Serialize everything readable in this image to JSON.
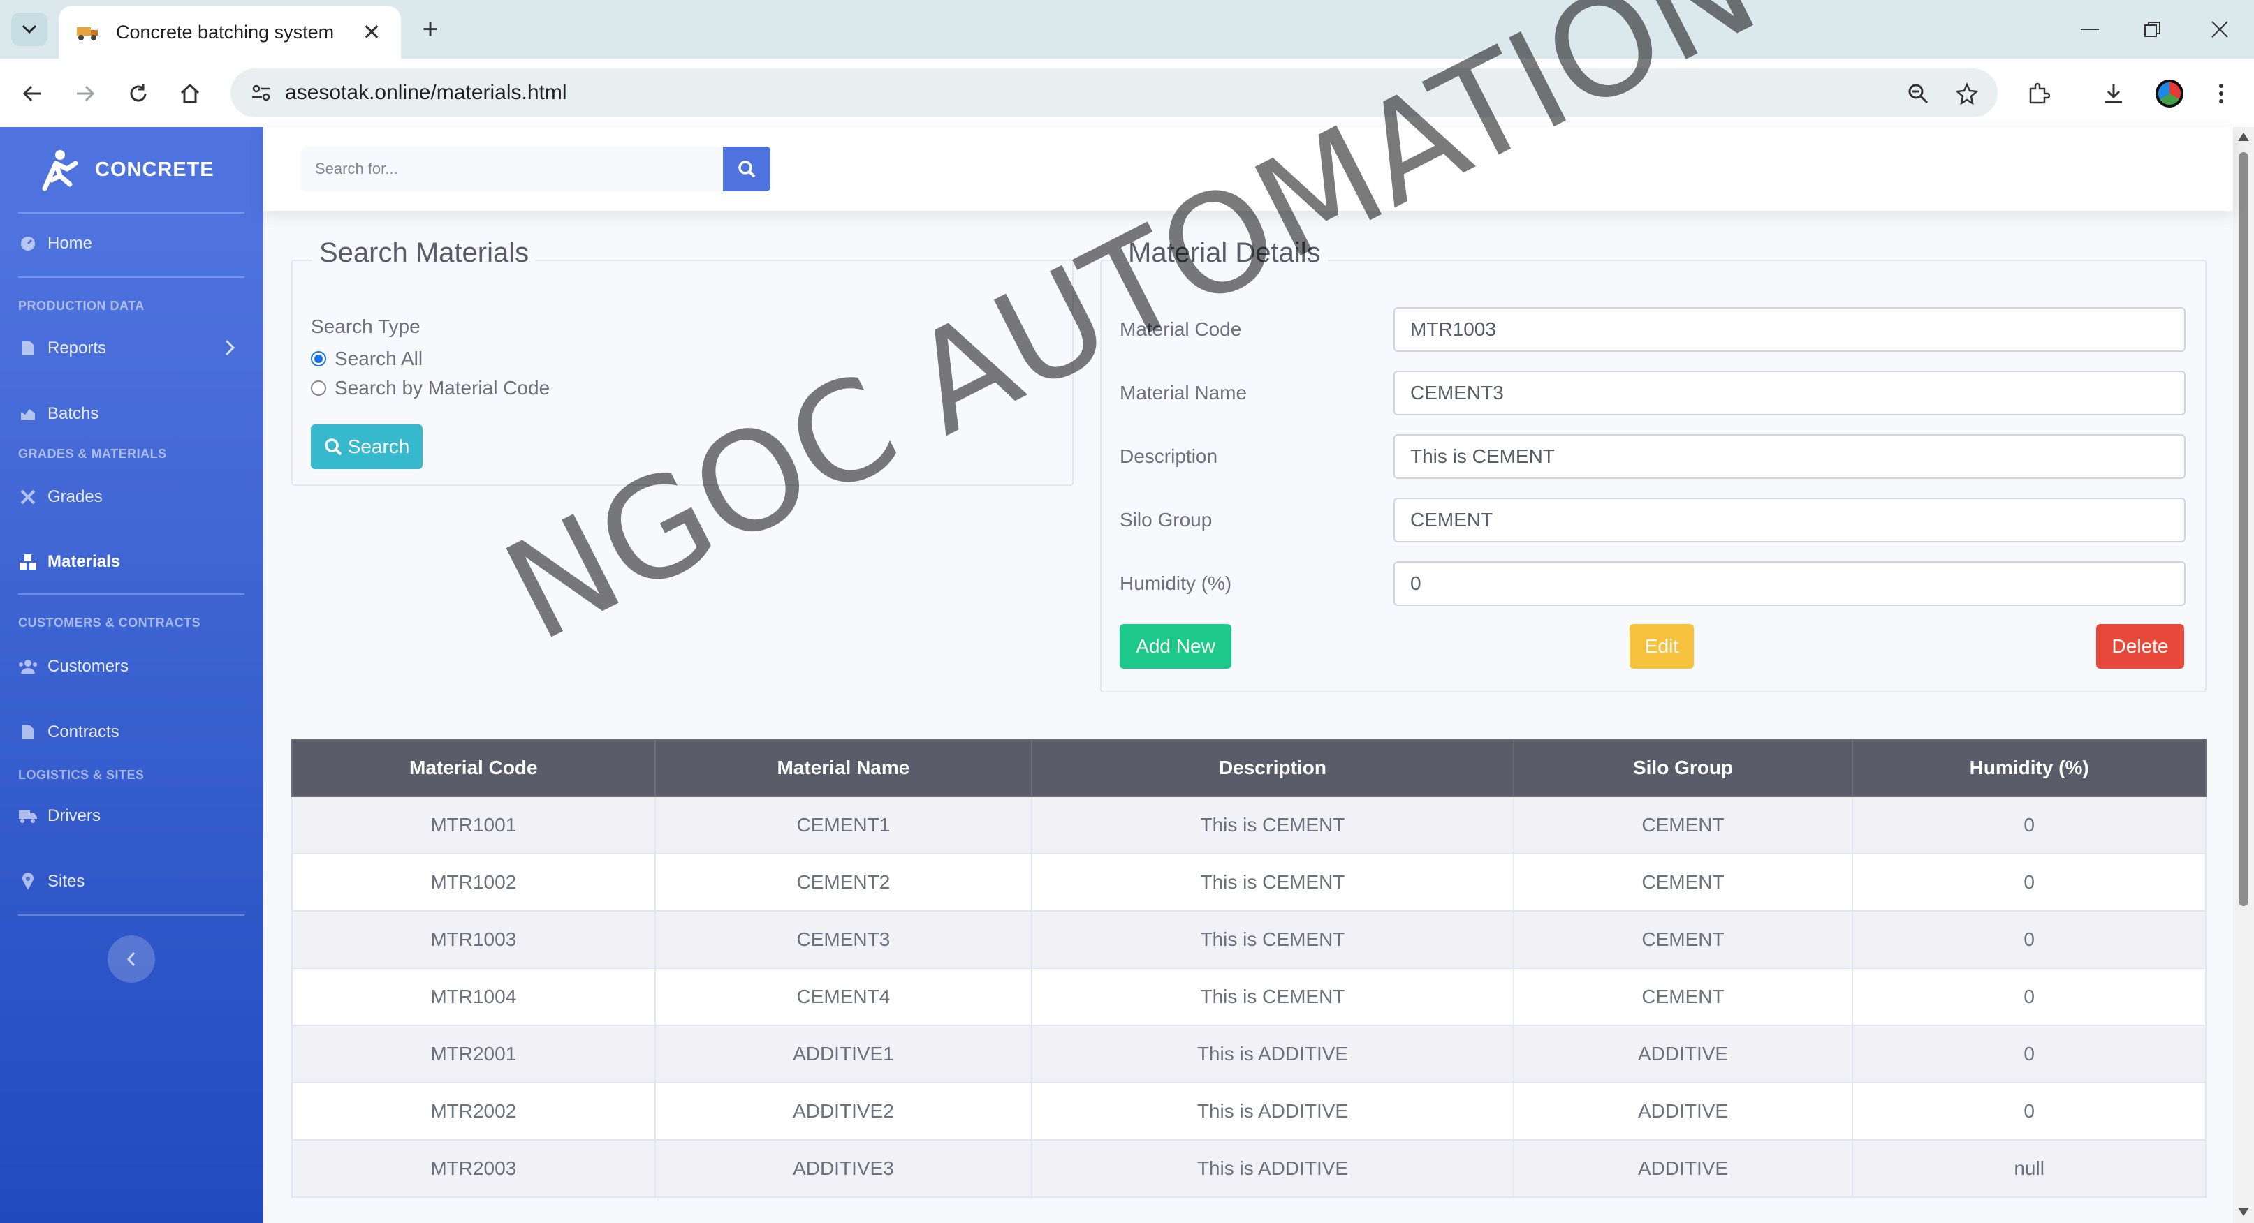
{
  "browser": {
    "tab_title": "Concrete batching system",
    "url": "asesotak.online/materials.html"
  },
  "sidebar": {
    "brand": "CONCRETE",
    "items": [
      {
        "label": "Home"
      },
      {
        "heading": "PRODUCTION DATA"
      },
      {
        "label": "Reports"
      },
      {
        "label": "Batchs"
      },
      {
        "heading": "GRADES & MATERIALS"
      },
      {
        "label": "Grades"
      },
      {
        "label": "Materials"
      },
      {
        "heading": "CUSTOMERS & CONTRACTS"
      },
      {
        "label": "Customers"
      },
      {
        "label": "Contracts"
      },
      {
        "heading": "LOGISTICS & SITES"
      },
      {
        "label": "Drivers"
      },
      {
        "label": "Sites"
      }
    ]
  },
  "topbar": {
    "search_placeholder": "Search for..."
  },
  "search_panel": {
    "legend": "Search Materials",
    "search_type_label": "Search Type",
    "options": [
      "Search All",
      "Search by Material Code"
    ],
    "selected": "Search All",
    "search_button": "Search"
  },
  "details_panel": {
    "legend": "Material Details",
    "fields": [
      {
        "label": "Material Code",
        "value": "MTR1003"
      },
      {
        "label": "Material Name",
        "value": "CEMENT3"
      },
      {
        "label": "Description",
        "value": "This is CEMENT"
      },
      {
        "label": "Silo Group",
        "value": "CEMENT"
      },
      {
        "label": "Humidity (%)",
        "value": "0"
      }
    ],
    "add_button": "Add New",
    "edit_button": "Edit",
    "delete_button": "Delete"
  },
  "table": {
    "headers": [
      "Material Code",
      "Material Name",
      "Description",
      "Silo Group",
      "Humidity (%)"
    ],
    "rows": [
      [
        "MTR1001",
        "CEMENT1",
        "This is CEMENT",
        "CEMENT",
        "0"
      ],
      [
        "MTR1002",
        "CEMENT2",
        "This is CEMENT",
        "CEMENT",
        "0"
      ],
      [
        "MTR1003",
        "CEMENT3",
        "This is CEMENT",
        "CEMENT",
        "0"
      ],
      [
        "MTR1004",
        "CEMENT4",
        "This is CEMENT",
        "CEMENT",
        "0"
      ],
      [
        "MTR2001",
        "ADDITIVE1",
        "This is ADDITIVE",
        "ADDITIVE",
        "0"
      ],
      [
        "MTR2002",
        "ADDITIVE2",
        "This is ADDITIVE",
        "ADDITIVE",
        "0"
      ],
      [
        "MTR2003",
        "ADDITIVE3",
        "This is ADDITIVE",
        "ADDITIVE",
        "null"
      ]
    ]
  },
  "watermark": "NGOC AUTOMATION",
  "colors": {
    "sidebar_top": "#4e73df",
    "sidebar_bottom": "#224abe",
    "table_header": "#5a5c69",
    "success": "#1cc88a",
    "warning": "#f6c23e",
    "danger": "#e74a3b",
    "info": "#36b9cc"
  }
}
